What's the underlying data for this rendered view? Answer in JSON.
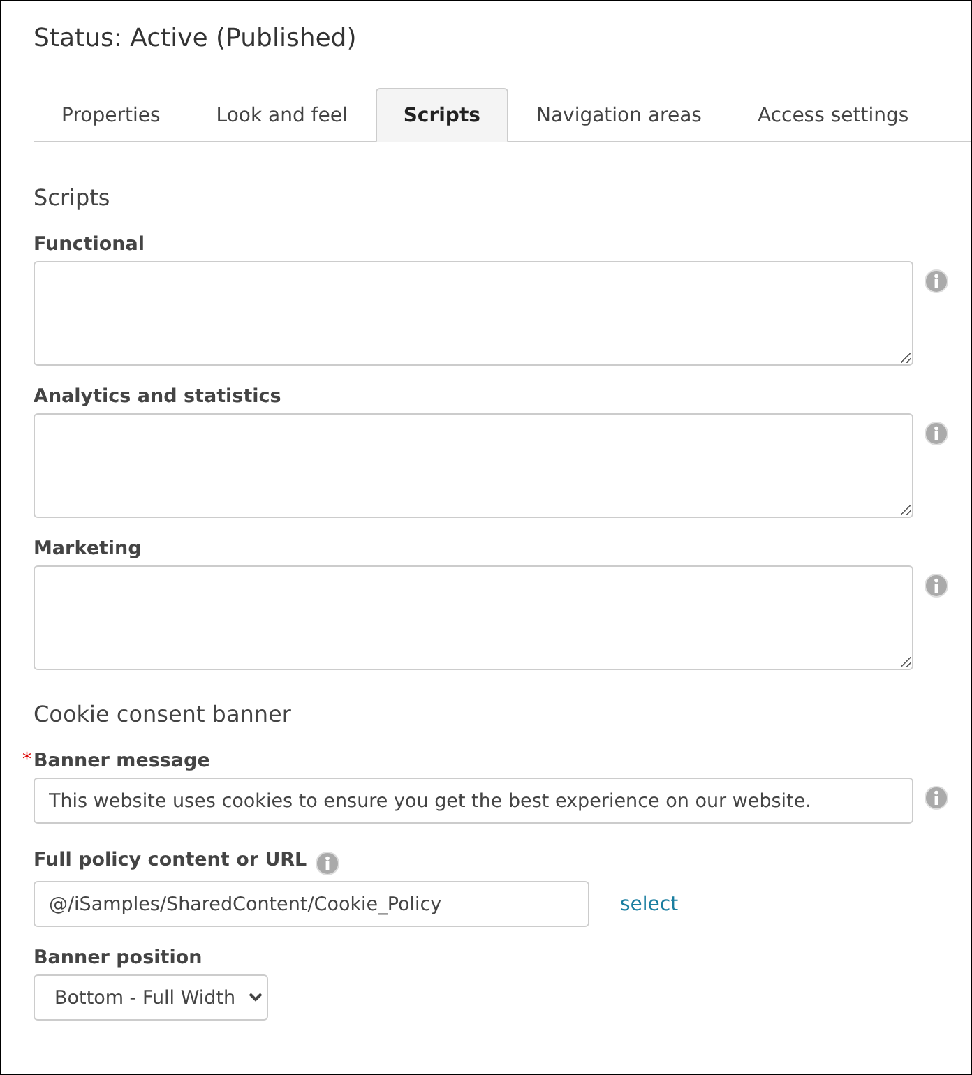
{
  "status_title": "Status: Active (Published)",
  "tabs": [
    {
      "label": "Properties",
      "selected": false
    },
    {
      "label": "Look and feel",
      "selected": false
    },
    {
      "label": "Scripts",
      "selected": true
    },
    {
      "label": "Navigation areas",
      "selected": false
    },
    {
      "label": "Access settings",
      "selected": false
    }
  ],
  "scripts_section": {
    "heading": "Scripts",
    "fields": [
      {
        "label": "Functional"
      },
      {
        "label": "Analytics and statistics"
      },
      {
        "label": "Marketing"
      }
    ]
  },
  "cookie_section": {
    "heading": "Cookie consent banner",
    "banner_message": {
      "label": "Banner message",
      "required_mark": "*",
      "value": "This website uses cookies to ensure you get the best experience on our website."
    },
    "policy": {
      "label": "Full policy content or URL",
      "value": "@/iSamples/SharedContent/Cookie_Policy",
      "link": "select"
    },
    "position": {
      "label": "Banner position",
      "value": "Bottom - Full Width"
    }
  }
}
